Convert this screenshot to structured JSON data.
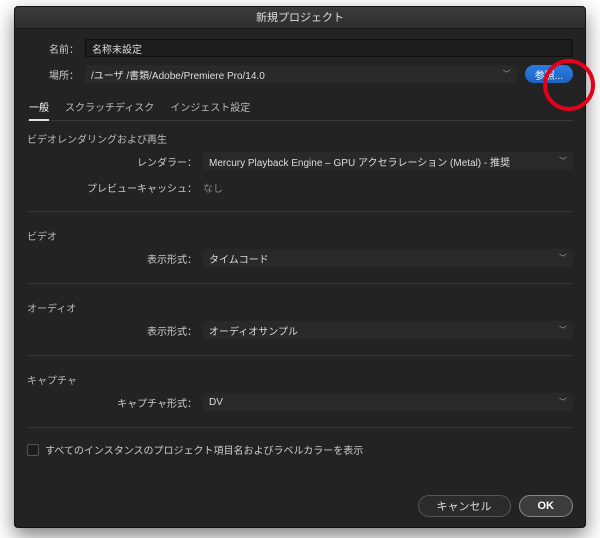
{
  "window": {
    "title": "新規プロジェクト"
  },
  "name_row": {
    "label": "名前：",
    "value": "名称未設定"
  },
  "location_row": {
    "label": "場所：",
    "value": "/ユーザ         /書類/Adobe/Premiere Pro/14.0",
    "browse_label": "参照..."
  },
  "tabs": {
    "general": "一般",
    "scratch": "スクラッチディスク",
    "ingest": "インジェスト設定"
  },
  "sections": {
    "video_rendering": "ビデオレンダリングおよび再生",
    "renderer_label": "レンダラー：",
    "renderer_value": "Mercury Playback Engine – GPU アクセラレーション (Metal) - 推奨",
    "preview_cache_label": "プレビューキャッシュ：",
    "preview_cache_value": "なし",
    "video": "ビデオ",
    "display_format_label": "表示形式：",
    "video_display_value": "タイムコード",
    "audio": "オーディオ",
    "audio_display_value": "オーディオサンプル",
    "capture": "キャプチャ",
    "capture_format_label": "キャプチャ形式：",
    "capture_format_value": "DV"
  },
  "checkbox": {
    "label": "すべてのインスタンスのプロジェクト項目名およびラベルカラーを表示"
  },
  "buttons": {
    "cancel": "キャンセル",
    "ok": "OK"
  }
}
